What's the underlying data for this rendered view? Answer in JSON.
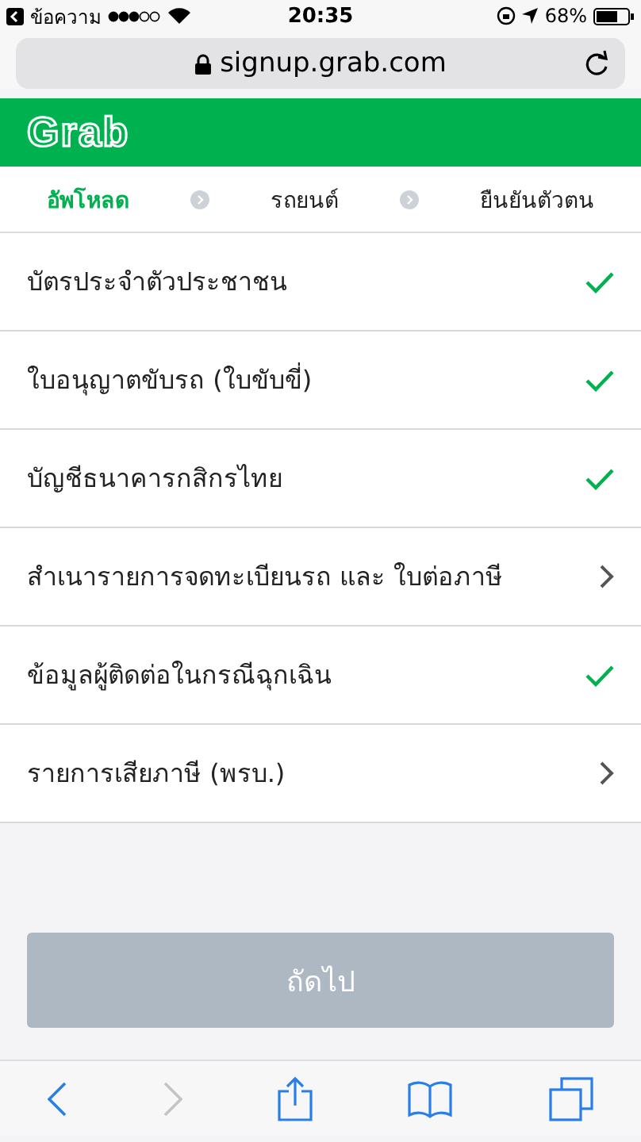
{
  "status_bar": {
    "back_app": "ข้อความ",
    "time": "20:35",
    "battery": "68%"
  },
  "address_bar": {
    "url": "signup.grab.com"
  },
  "header": {
    "logo": "Grab"
  },
  "steps": [
    {
      "label": "อัพโหลด",
      "selected": true
    },
    {
      "label": "รถยนต์",
      "selected": false
    },
    {
      "label": "ยืนยันตัวตน",
      "selected": false
    }
  ],
  "items": [
    {
      "label": "บัตรประจำตัวประชาชน",
      "kind": "done"
    },
    {
      "label": "ใบอนุญาตขับรถ (ใบขับขี่)",
      "kind": "done"
    },
    {
      "label": "บัญชีธนาคารกสิกรไทย",
      "kind": "done"
    },
    {
      "label": "สำเนารายการจดทะเบียนรถ และ ใบต่อภาษี",
      "kind": "link"
    },
    {
      "label": "ข้อมูลผู้ติดต่อในกรณีฉุกเฉิน",
      "kind": "done"
    },
    {
      "label": "รายการเสียภาษี (พรบ.)",
      "kind": "link"
    }
  ],
  "next_button": {
    "label": "ถัดไป",
    "disabled": true
  },
  "toolbar": {
    "forward_disabled": true
  }
}
